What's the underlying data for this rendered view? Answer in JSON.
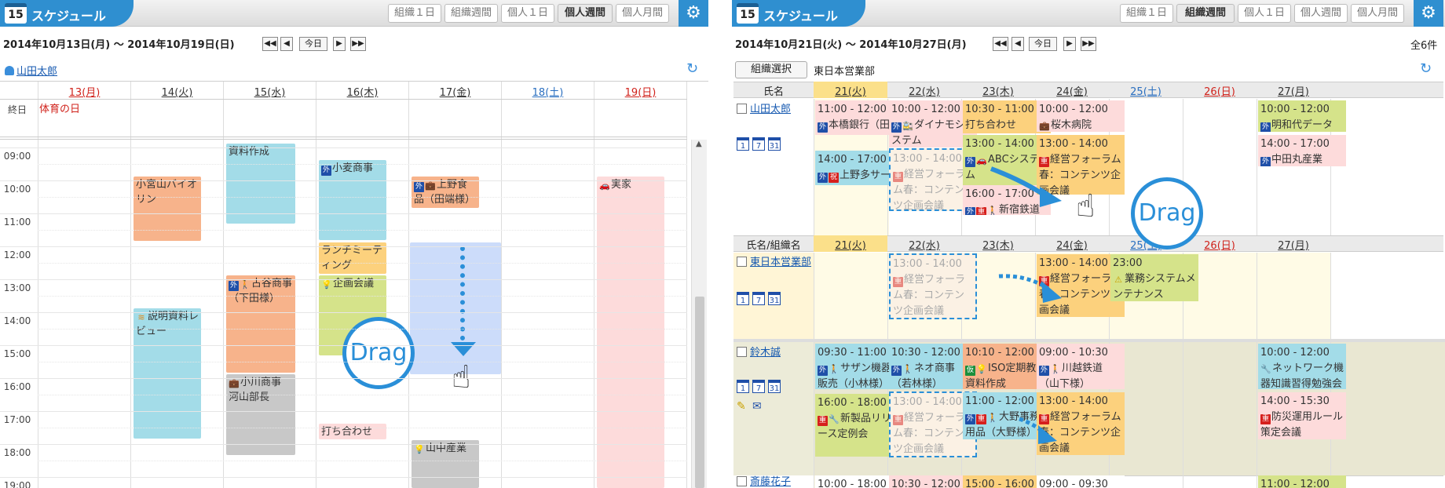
{
  "app": {
    "title": "スケジュール",
    "icon_number": "15"
  },
  "left": {
    "view_buttons": [
      "組織１日",
      "組織週間",
      "個人１日",
      "個人週間",
      "個人月間"
    ],
    "active_view": "個人週間",
    "date_range": "2014年10月13日(月) 〜 2014年10月19日(日)",
    "nav": {
      "first": "◀◀",
      "prev": "◀",
      "today": "今日",
      "next": "▶",
      "last": "▶▶"
    },
    "user": "山田太郎",
    "allday_label": "終日",
    "days": [
      "13(月)",
      "14(火)",
      "15(水)",
      "16(木)",
      "17(金)",
      "18(土)",
      "19(日)"
    ],
    "holiday": "体育の日",
    "hours": [
      "09:00",
      "10:00",
      "11:00",
      "12:00",
      "13:00",
      "14:00",
      "15:00",
      "16:00",
      "17:00",
      "18:00",
      "19:00"
    ],
    "events": {
      "e1": "資料作成",
      "e2": "小宮山バイオリン",
      "e3": "小麦商事",
      "e4": "上野食品（田端様）",
      "e5": "実家",
      "e6": "ランチミーティング",
      "e7": "古谷商事（下田様）",
      "e8": "企画会議",
      "e9": "説明資料レビュー",
      "e10": "小川商事 河山部長",
      "e11": "打ち合わせ",
      "e12": "山中産業"
    },
    "drag_label": "Drag"
  },
  "right": {
    "view_buttons": [
      "組織１日",
      "組織週間",
      "個人１日",
      "個人週間",
      "個人月間"
    ],
    "active_view": "組織週間",
    "date_range": "2014年10月21日(火) 〜 2014年10月27日(月)",
    "nav": {
      "first": "◀◀",
      "prev": "◀",
      "today": "今日",
      "next": "▶",
      "last": "▶▶"
    },
    "count": "全6件",
    "org_select_label": "組織選択",
    "org_name": "東日本営業部",
    "col_name": "氏名",
    "col_name_org": "氏名/組織名",
    "days": [
      "21(火)",
      "22(水)",
      "23(木)",
      "24(金)",
      "25(土)",
      "26(日)",
      "27(月)"
    ],
    "people": {
      "p1": "山田太郎",
      "org": "東日本営業部",
      "p2": "鈴木誠",
      "p3": "斎藤花子"
    },
    "ev": {
      "a1t": "11:00 - 12:00",
      "a1": "本橋銀行（田町様）",
      "a2t": "14:00 - 17:00",
      "a2": "上野多サービス",
      "b1t": "10:00 - 12:00",
      "b1": "ダイナモシステム",
      "b2t": "13:00 - 14:00",
      "b2": "経営フォーラム春：コンテンツ企画会議",
      "c1t": "10:30 - 11:00",
      "c1": "打ち合わせ",
      "c2t": "13:00 - 14:00",
      "c2": "ABCシステム",
      "c3t": "16:00 - 17:00",
      "c3": "新宿鉄道",
      "d1t": "10:00 - 12:00",
      "d1": "桜木病院",
      "d2t": "13:00 - 14:00",
      "d2": "経営フォーラム春：コンテンツ企画会議",
      "g1t": "10:00 - 12:00",
      "g1": "明和代データ",
      "g2t": "14:00 - 17:00",
      "g2": "中田丸産業",
      "ob1t": "13:00 - 14:00",
      "ob1": "経営フォーラム春：コンテンツ企画会議",
      "od1t": "13:00 - 14:00",
      "od1": "経営フォーラム春：コンテンツ企画会議",
      "oe1t": "23:00",
      "oe1": "業務システムメンテナンス",
      "s_a1t": "09:30 - 11:00",
      "s_a1": "サザン機器販売（小林様）",
      "s_a2t": "16:00 - 18:00",
      "s_a2": "新製品リリース定例会",
      "s_b1t": "10:30 - 12:00",
      "s_b1": "ネオ商事（若林様）",
      "s_b2t": "13:00 - 14:00",
      "s_b2": "経営フォーラム春：コンテンツ企画会議",
      "s_c1t": "10:10 - 12:00",
      "s_c1": "ISO定期教育資料作成",
      "s_c2t": "11:00 - 12:00",
      "s_c2": "大野事務用品（大野様）",
      "s_d1t": "09:00 - 10:30",
      "s_d1": "川越鉄道（山下様）",
      "s_d2t": "13:00 - 14:00",
      "s_d2": "経営フォーラム春：コンテンツ企画会議",
      "s_g1t": "10:00 - 12:00",
      "s_g1": "ネットワーク機器知識習得勉強会",
      "s_g2t": "14:00 - 15:30",
      "s_g2": "防災運用ルール策定会議",
      "h_a1t": "10:00 - 18:00",
      "h_b1t": "10:30 - 12:00",
      "h_c1t": "15:00 - 16:00",
      "h_d1t": "09:00 - 09:30",
      "h_g1t": "11:00 - 12:00"
    },
    "drag_label": "Drag"
  },
  "colors": {
    "accent": "#2f8fd0",
    "drag": "#2a8fd8",
    "saturday": "#2a6fc0",
    "sunday": "#d0221b"
  }
}
